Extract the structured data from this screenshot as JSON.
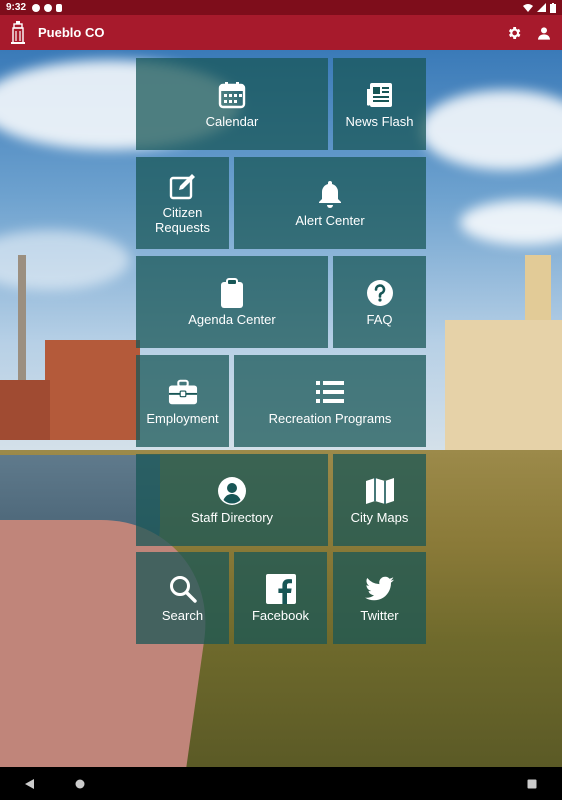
{
  "status_bar": {
    "time": "9:32"
  },
  "app_bar": {
    "title": "Pueblo CO",
    "actions": [
      "gear-icon",
      "account-icon"
    ]
  },
  "colors": {
    "app_bar": "#a71a2c",
    "status_bar": "#7e0d1b",
    "tile": "#185656"
  },
  "tiles": [
    {
      "label": "Calendar",
      "icon": "calendar-icon"
    },
    {
      "label": "News Flash",
      "icon": "newspaper-icon"
    },
    {
      "label": "Citizen\nRequests",
      "icon": "edit-icon"
    },
    {
      "label": "Alert Center",
      "icon": "bell-icon"
    },
    {
      "label": "Agenda Center",
      "icon": "clipboard-icon"
    },
    {
      "label": "FAQ",
      "icon": "question-icon"
    },
    {
      "label": "Employment",
      "icon": "briefcase-icon"
    },
    {
      "label": "Recreation Programs",
      "icon": "list-icon"
    },
    {
      "label": "Staff Directory",
      "icon": "person-icon"
    },
    {
      "label": "City Maps",
      "icon": "map-icon"
    },
    {
      "label": "Search",
      "icon": "search-icon"
    },
    {
      "label": "Facebook",
      "icon": "facebook-icon"
    },
    {
      "label": "Twitter",
      "icon": "twitter-icon"
    }
  ],
  "nav_bar": [
    "back-icon",
    "home-icon",
    "recents-icon"
  ]
}
